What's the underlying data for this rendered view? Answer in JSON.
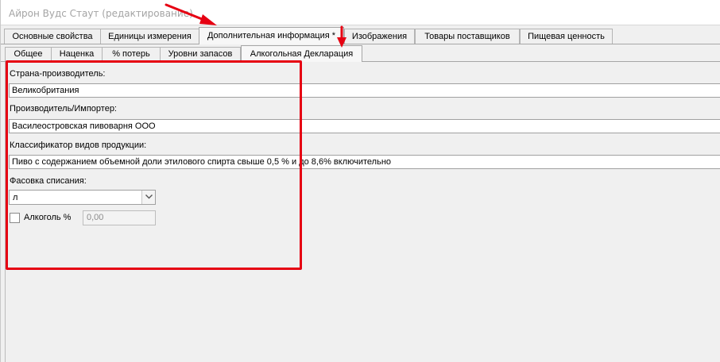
{
  "window": {
    "title": "Айрон Вудс Стаут (редактирование)"
  },
  "tabs_main": [
    {
      "label": "Основные свойства"
    },
    {
      "label": "Единицы измерения"
    },
    {
      "label": "Дополнительная информация *"
    },
    {
      "label": "Изображения"
    },
    {
      "label": "Товары поставщиков"
    },
    {
      "label": "Пищевая ценность"
    }
  ],
  "active_main_tab": "Дополнительная информация *",
  "tabs_sub": [
    {
      "label": "Общее"
    },
    {
      "label": "Наценка"
    },
    {
      "label": "% потерь"
    },
    {
      "label": "Уровни запасов"
    },
    {
      "label": "Алкогольная Декларация"
    }
  ],
  "active_sub_tab": "Алкогольная Декларация",
  "form": {
    "country": {
      "label": "Страна-производитель:",
      "value": "Великобритания"
    },
    "manufacturer": {
      "label": "Производитель/Импортер:",
      "value": "Василеостровская пивоварня ООО"
    },
    "classifier": {
      "label": "Классификатор видов продукции:",
      "value": "Пиво с  содержанием объемной  доли этилового спирта  свыше 0,5 %  и до 8,6%  включительно"
    },
    "packaging": {
      "label": "Фасовка списания:",
      "value": "л"
    },
    "alcohol": {
      "label": "Алкоголь %",
      "value": "0,00",
      "checked": false
    }
  },
  "annotation": {
    "color": "#e60012"
  },
  "colors": {
    "background": "#f0f0f0",
    "input_border": "#a0a0a0",
    "tab_border": "#b4b4b4"
  }
}
